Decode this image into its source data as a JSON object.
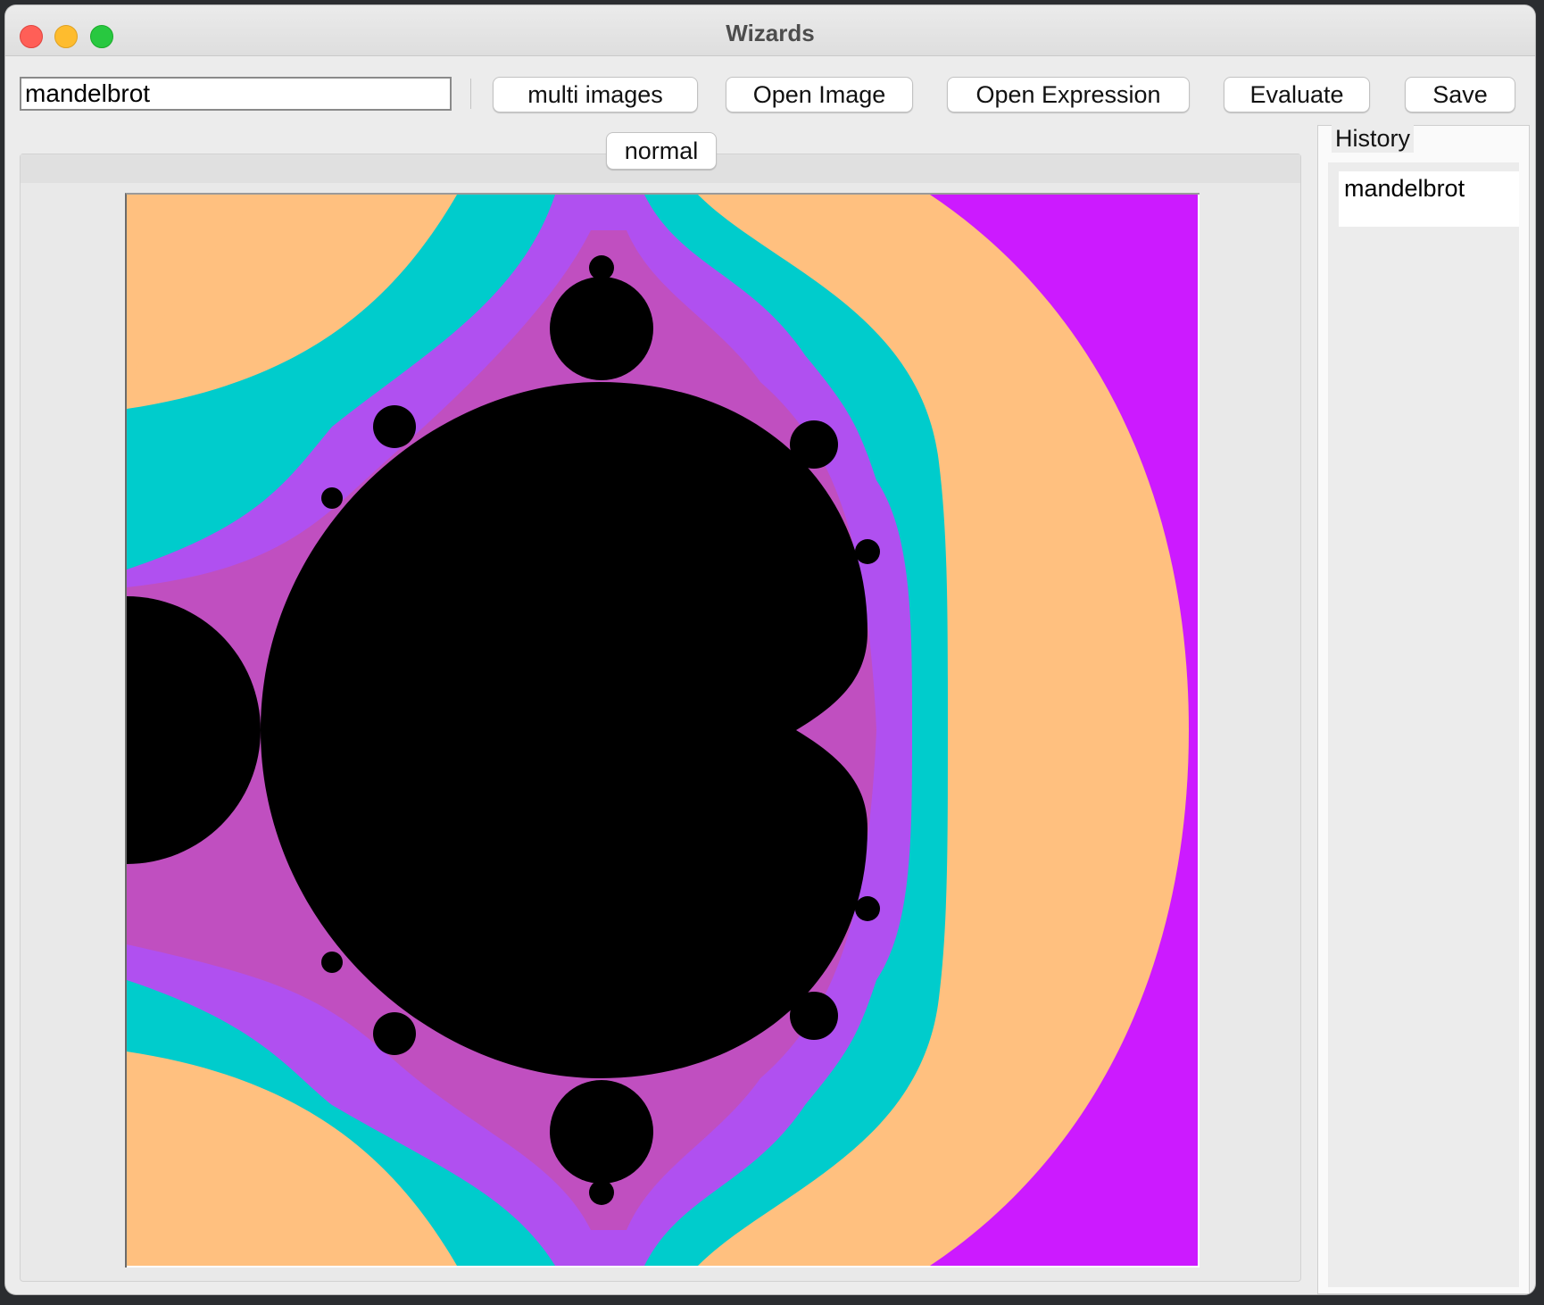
{
  "window": {
    "title": "Wizards"
  },
  "toolbar": {
    "expression_value": "mandelbrot",
    "multi_images_label": "multi images",
    "open_image_label": "Open Image",
    "open_expression_label": "Open Expression",
    "evaluate_label": "Evaluate",
    "save_label": "Save"
  },
  "image_panel": {
    "mode_label": "normal",
    "colors": {
      "set": "#000000",
      "band1": "#c04fc0",
      "band2": "#b050f0",
      "band3": "#00cccc",
      "band4": "#ffc07f",
      "band5": "#cc1aff"
    }
  },
  "history": {
    "title": "History",
    "items": [
      "mandelbrot"
    ]
  }
}
